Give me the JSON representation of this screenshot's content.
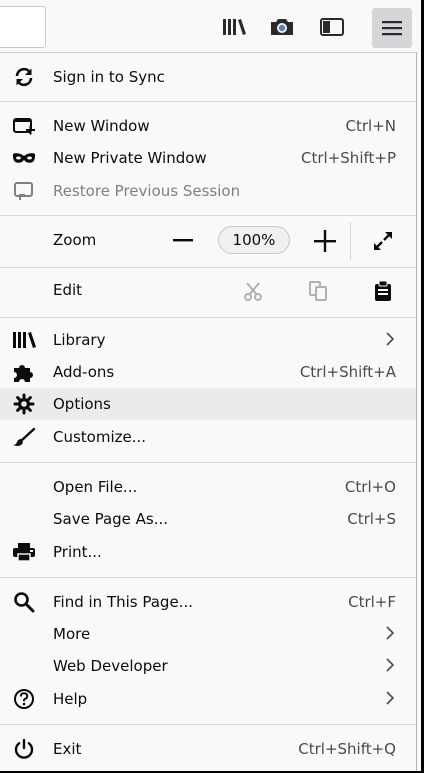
{
  "toolbar": {
    "icons": [
      "library-icon",
      "screenshot-icon",
      "sidebar-icon",
      "hamburger-menu-icon"
    ]
  },
  "menu": {
    "sign_in": "Sign in to Sync",
    "new_window": {
      "label": "New Window",
      "shortcut": "Ctrl+N"
    },
    "new_private_window": {
      "label": "New Private Window",
      "shortcut": "Ctrl+Shift+P"
    },
    "restore_session": {
      "label": "Restore Previous Session"
    },
    "zoom": {
      "label": "Zoom",
      "level": "100%"
    },
    "edit": {
      "label": "Edit"
    },
    "library": {
      "label": "Library"
    },
    "addons": {
      "label": "Add-ons",
      "shortcut": "Ctrl+Shift+A"
    },
    "options": {
      "label": "Options"
    },
    "customize": {
      "label": "Customize..."
    },
    "open_file": {
      "label": "Open File...",
      "shortcut": "Ctrl+O"
    },
    "save_page": {
      "label": "Save Page As...",
      "shortcut": "Ctrl+S"
    },
    "print": {
      "label": "Print..."
    },
    "find": {
      "label": "Find in This Page...",
      "shortcut": "Ctrl+F"
    },
    "more": {
      "label": "More"
    },
    "web_developer": {
      "label": "Web Developer"
    },
    "help": {
      "label": "Help"
    },
    "exit": {
      "label": "Exit",
      "shortcut": "Ctrl+Shift+Q"
    }
  },
  "colors": {
    "panel_bg": "#f9f9fa",
    "highlight": "#ebebeb",
    "text": "#0c0c0d",
    "disabled_text": "#808083",
    "shortcut_text": "#4a4a4f"
  }
}
